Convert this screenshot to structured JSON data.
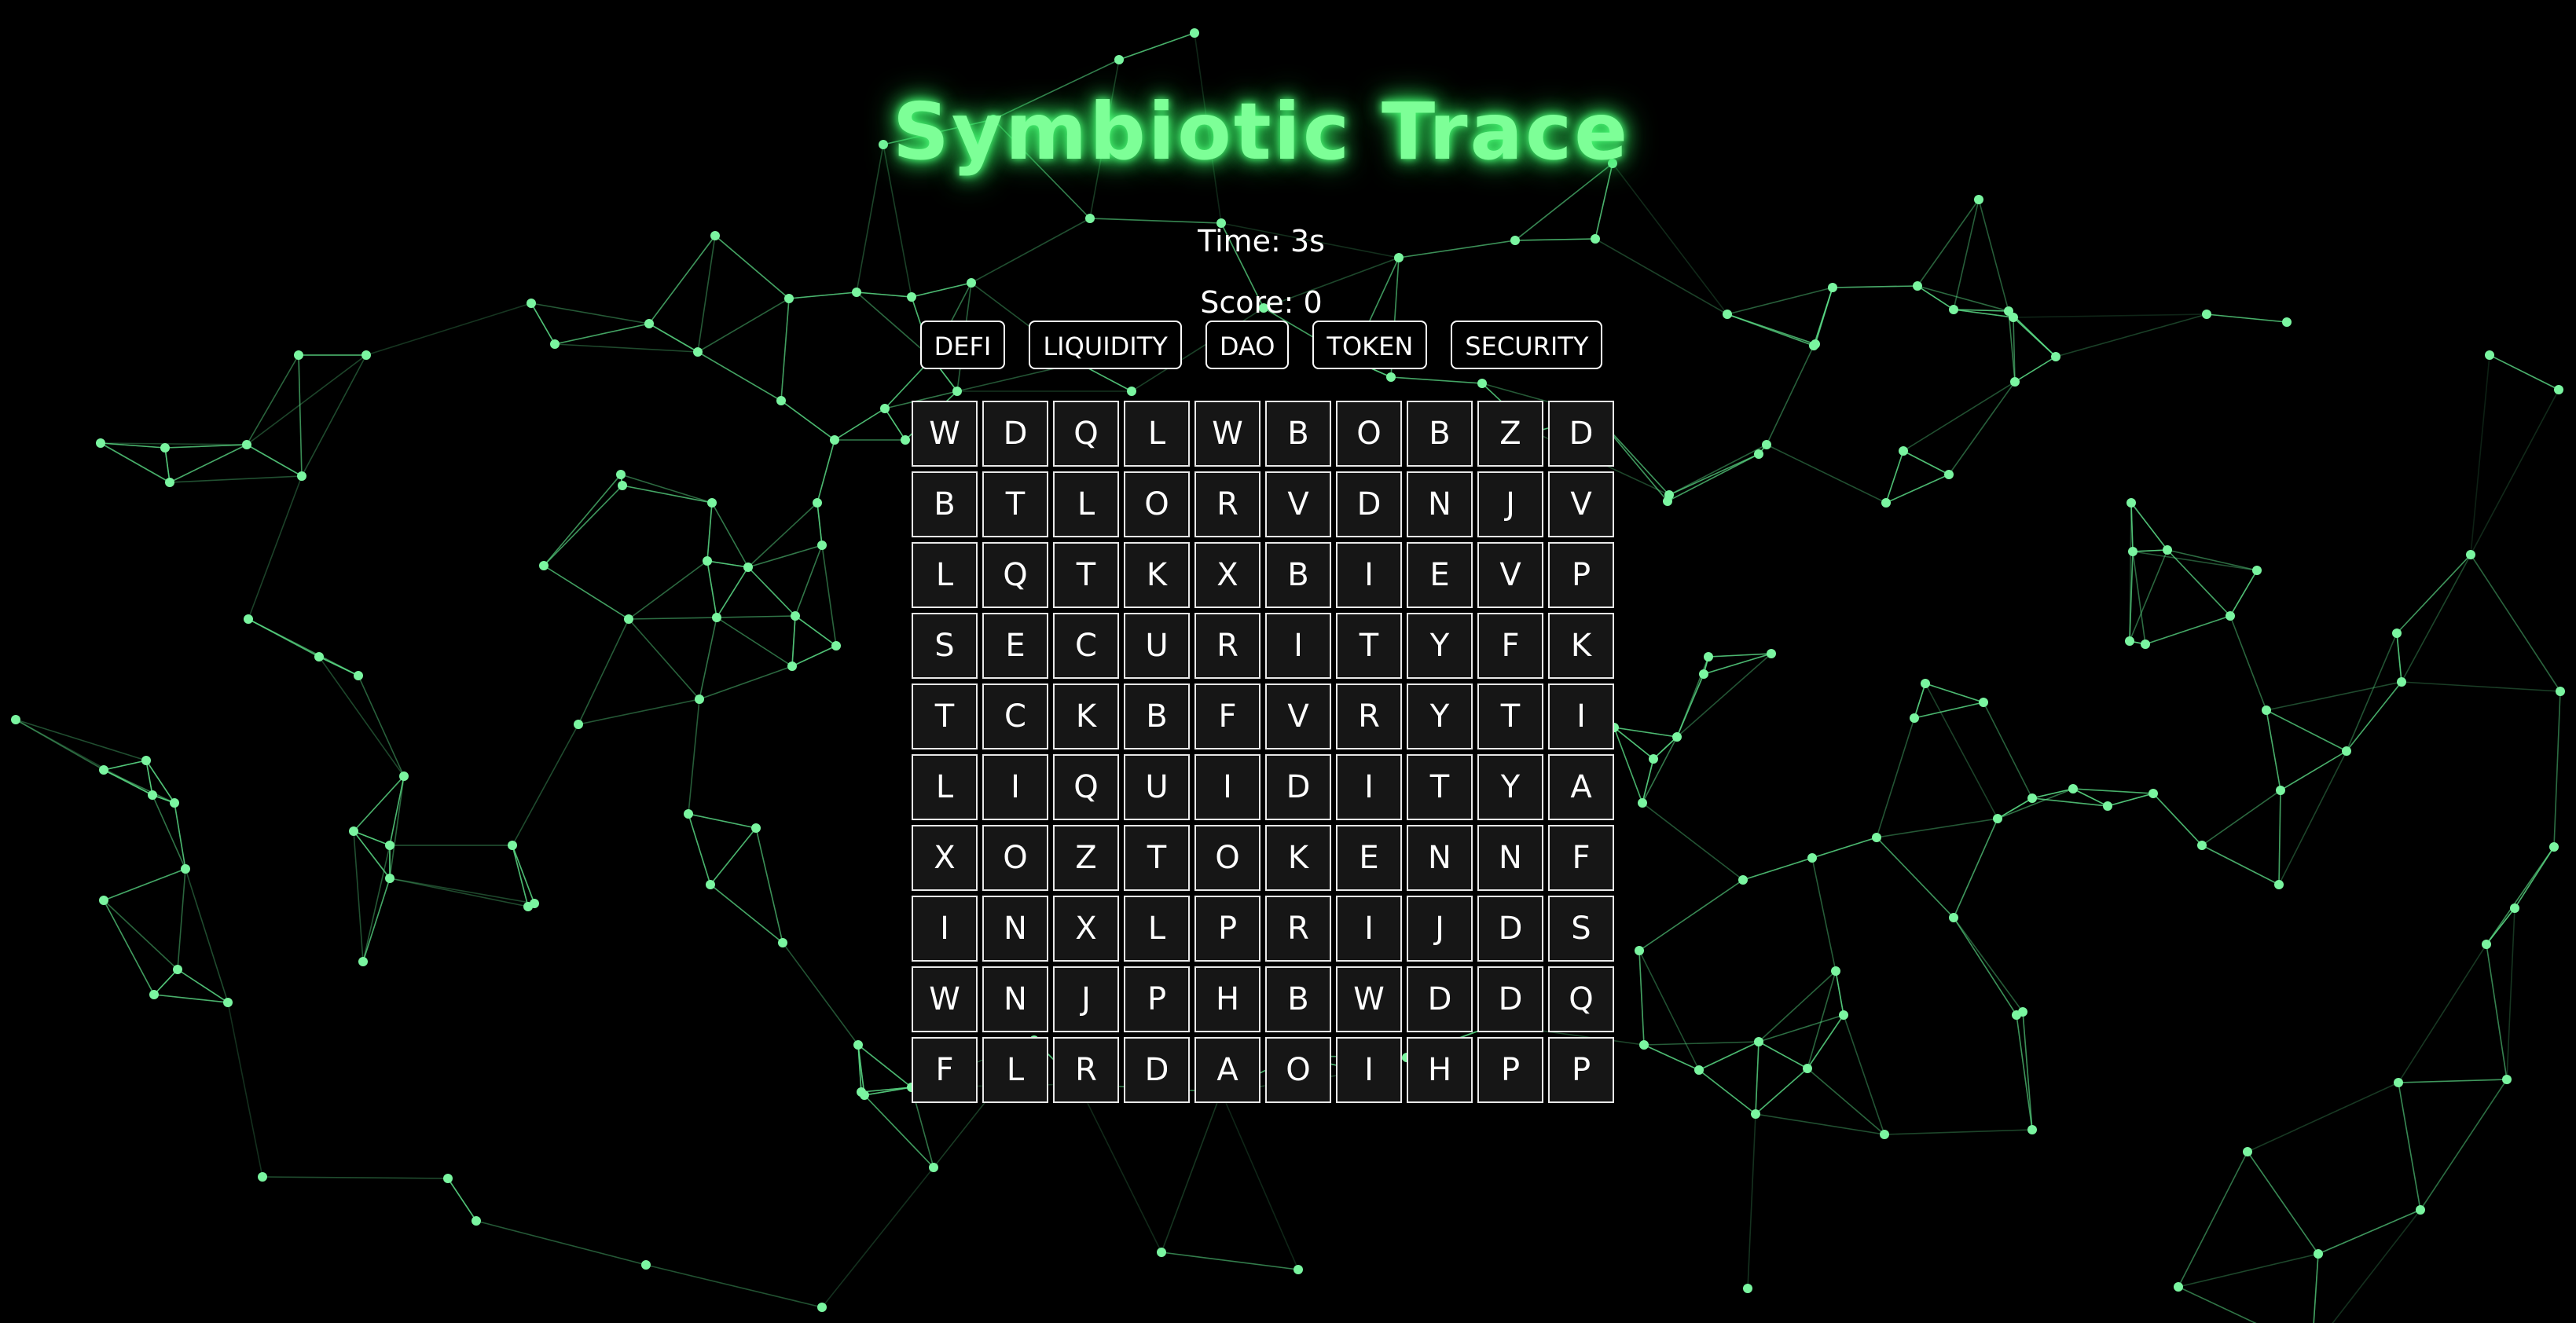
{
  "title": "Symbiotic Trace",
  "hud": {
    "time_label": "Time: 3s",
    "score_label": "Score: 0"
  },
  "words": [
    "DEFI",
    "LIQUIDITY",
    "DAO",
    "TOKEN",
    "SECURITY"
  ],
  "grid": [
    [
      "W",
      "D",
      "Q",
      "L",
      "W",
      "B",
      "O",
      "B",
      "Z",
      "D"
    ],
    [
      "B",
      "T",
      "L",
      "O",
      "R",
      "V",
      "D",
      "N",
      "J",
      "V"
    ],
    [
      "L",
      "Q",
      "T",
      "K",
      "X",
      "B",
      "I",
      "E",
      "V",
      "P"
    ],
    [
      "S",
      "E",
      "C",
      "U",
      "R",
      "I",
      "T",
      "Y",
      "F",
      "K"
    ],
    [
      "T",
      "C",
      "K",
      "B",
      "F",
      "V",
      "R",
      "Y",
      "T",
      "I"
    ],
    [
      "L",
      "I",
      "Q",
      "U",
      "I",
      "D",
      "I",
      "T",
      "Y",
      "A"
    ],
    [
      "X",
      "O",
      "Z",
      "T",
      "O",
      "K",
      "E",
      "N",
      "N",
      "F"
    ],
    [
      "I",
      "N",
      "X",
      "L",
      "P",
      "R",
      "I",
      "J",
      "D",
      "S"
    ],
    [
      "W",
      "N",
      "J",
      "P",
      "H",
      "B",
      "W",
      "D",
      "D",
      "Q"
    ],
    [
      "F",
      "L",
      "R",
      "D",
      "A",
      "O",
      "I",
      "H",
      "P",
      "P"
    ]
  ],
  "colors": {
    "background": "#000000",
    "accent": "#7dff97",
    "network": "#5fe58c",
    "cell_fill": "#161616",
    "cell_border": "#e8e8e8"
  }
}
